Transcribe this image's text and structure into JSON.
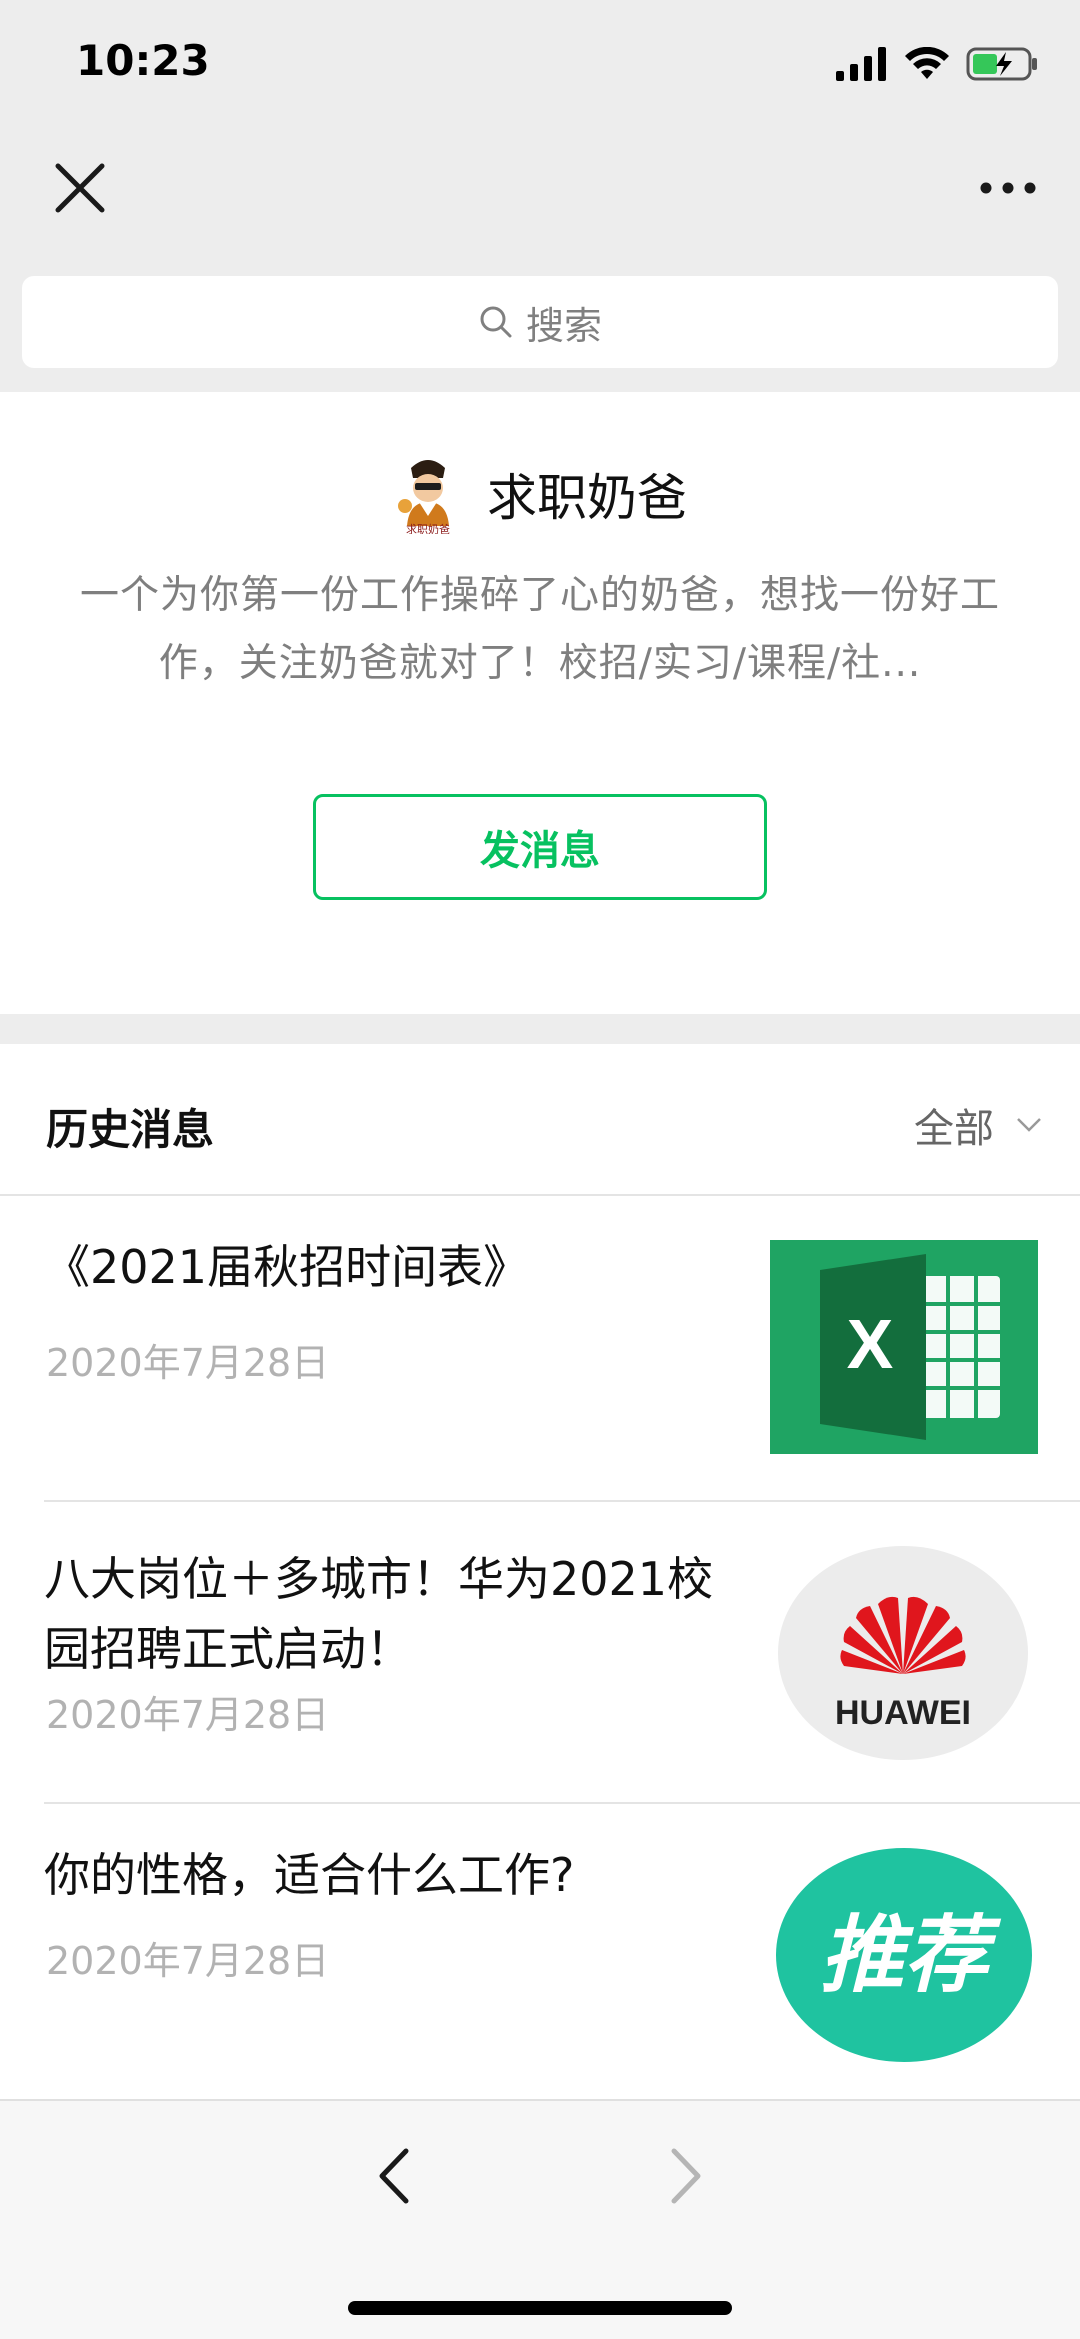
{
  "status_bar": {
    "time": "10:23"
  },
  "search": {
    "placeholder": "搜索"
  },
  "profile": {
    "name": "求职奶爸",
    "avatar_text": "求职奶爸",
    "description": "一个为你第一份工作操碎了心的奶爸，想找一份好工作，关注奶爸就对了！校招/实习/课程/社...",
    "send_button": "发消息"
  },
  "history": {
    "title": "历史消息",
    "filter_label": "全部",
    "articles": [
      {
        "title": "《2021届秋招时间表》",
        "date": "2020年7月28日",
        "thumb": "excel-icon"
      },
      {
        "title": "八大岗位＋多城市！华为2021校园招聘正式启动！",
        "date": "2020年7月28日",
        "thumb": "huawei-logo",
        "thumb_text": "HUAWEI"
      },
      {
        "title": "你的性格，适合什么工作?",
        "date": "2020年7月28日",
        "thumb": "recommend-badge",
        "thumb_text": "推荐"
      }
    ]
  },
  "colors": {
    "accent_green": "#07c160",
    "excel_green": "#1fa463",
    "huawei_red": "#e0161d",
    "recommend_teal": "#1fc3a0"
  }
}
